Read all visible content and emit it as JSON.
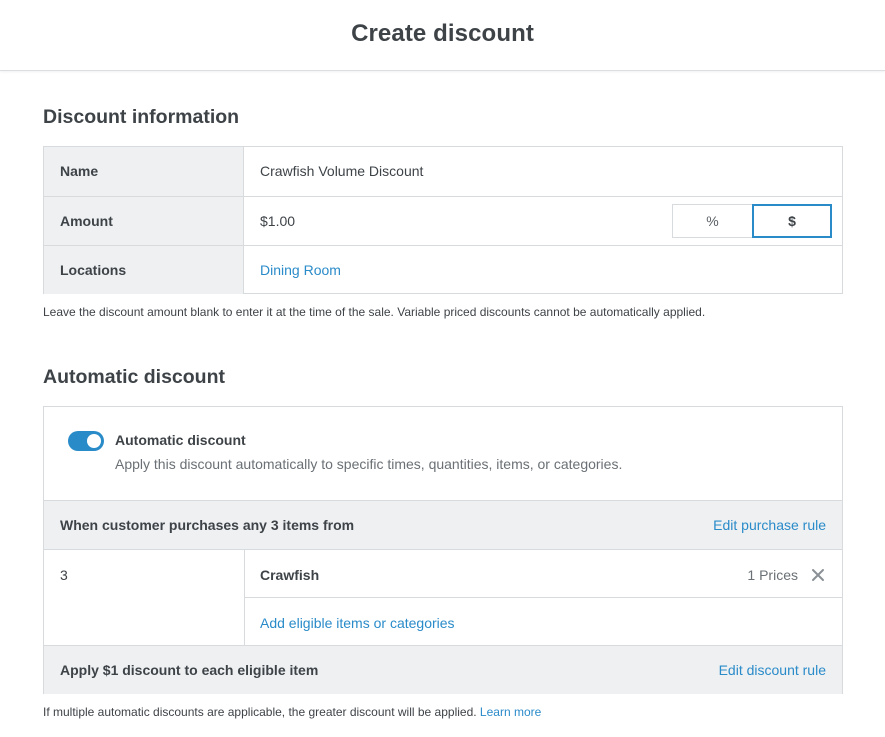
{
  "header": {
    "title": "Create discount"
  },
  "discount_info": {
    "title": "Discount information",
    "name_label": "Name",
    "name_value": "Crawfish Volume Discount",
    "amount_label": "Amount",
    "amount_value": "$1.00",
    "amount_type_options": [
      "%",
      "$"
    ],
    "amount_type_selected": "$",
    "locations_label": "Locations",
    "locations_value": "Dining Room",
    "note": "Leave the discount amount blank to enter it at the time of the sale. Variable priced discounts cannot be automatically applied."
  },
  "automatic": {
    "title": "Automatic discount",
    "toggle_on": true,
    "toggle_label": "Automatic discount",
    "toggle_description": "Apply this discount automatically to specific times, quantities, items, or categories.",
    "purchase_rule": "When customer purchases any 3 items from",
    "edit_purchase_rule": "Edit purchase rule",
    "quantity": "3",
    "items": [
      {
        "name": "Crawfish",
        "prices": "1 Prices"
      }
    ],
    "add_items_link": "Add eligible items or categories",
    "discount_rule": "Apply $1 discount to each eligible item",
    "edit_discount_rule": "Edit discount rule",
    "footer_note": "If multiple automatic discounts are applicable, the greater discount will be applied.",
    "learn_more": "Learn more"
  },
  "colors": {
    "accent": "#2a8bc9",
    "label_bg": "#eef0f2",
    "border": "#d8dbde",
    "text": "#3e4348"
  },
  "icons": {
    "remove": "close-icon"
  }
}
